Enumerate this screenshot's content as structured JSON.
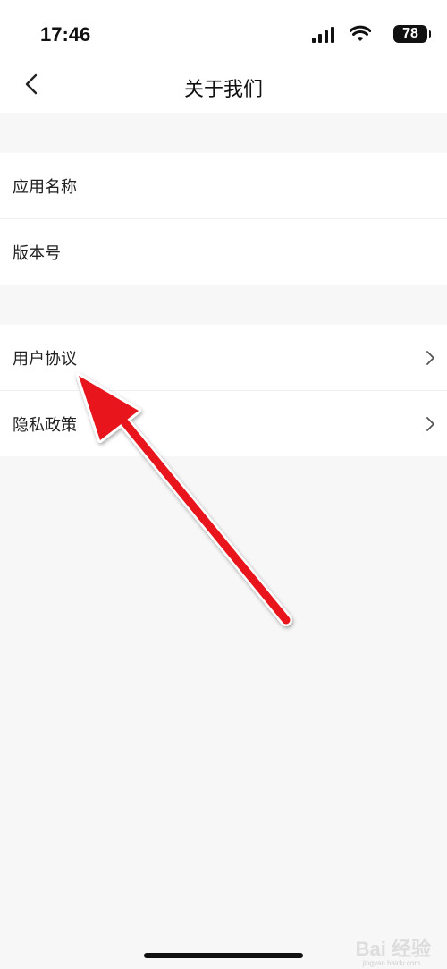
{
  "status": {
    "time": "17:46",
    "battery": "78"
  },
  "nav": {
    "title": "关于我们"
  },
  "info_rows": [
    {
      "label": "应用名称",
      "value": ""
    },
    {
      "label": "版本号",
      "value": ""
    }
  ],
  "link_rows": [
    {
      "label": "用户协议"
    },
    {
      "label": "隐私政策"
    }
  ],
  "annotation": {
    "arrow_color": "#e8131b"
  },
  "watermark": {
    "text": "Bai 经验",
    "sub": "jingyan.baidu.com"
  }
}
